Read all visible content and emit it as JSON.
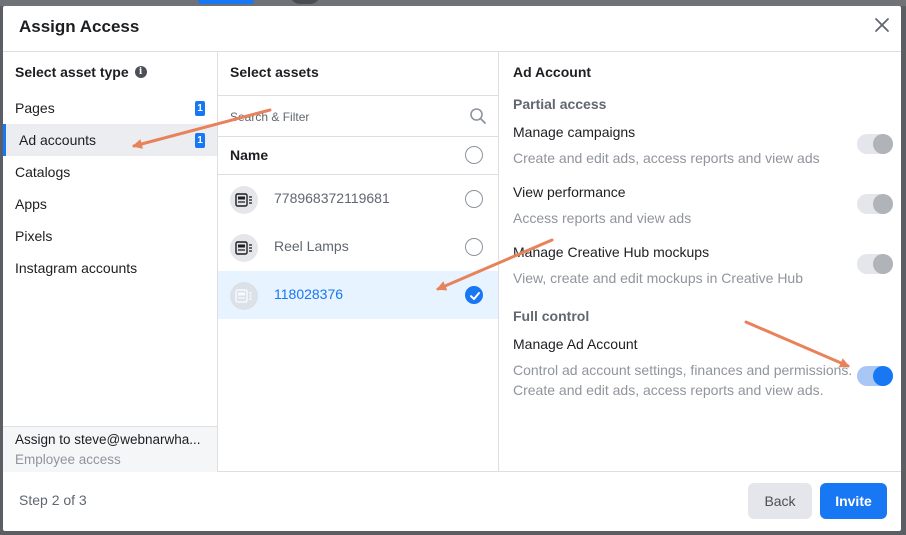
{
  "dialog": {
    "title": "Assign Access",
    "step": "Step 2 of 3",
    "back_label": "Back",
    "invite_label": "Invite"
  },
  "asset_types": {
    "header": "Select asset type",
    "items": [
      {
        "label": "Pages",
        "count": "1"
      },
      {
        "label": "Ad accounts",
        "count": "1",
        "selected": true
      },
      {
        "label": "Catalogs"
      },
      {
        "label": "Apps"
      },
      {
        "label": "Pixels"
      },
      {
        "label": "Instagram accounts"
      }
    ],
    "assign_to": "Assign to steve@webnarwha...",
    "assign_role": "Employee access"
  },
  "assets": {
    "header": "Select assets",
    "search_placeholder": "Search & Filter",
    "name_header": "Name",
    "items": [
      {
        "name": "778968372119681",
        "selected": false
      },
      {
        "name": "Reel Lamps",
        "selected": false
      },
      {
        "name": "118028376",
        "selected": true
      }
    ]
  },
  "permissions": {
    "header": "Ad Account",
    "partial_title": "Partial access",
    "full_title": "Full control",
    "items": [
      {
        "title": "Manage campaigns",
        "desc": "Create and edit ads, access reports and view ads",
        "enabled": false
      },
      {
        "title": "View performance",
        "desc": "Access reports and view ads",
        "enabled": false
      },
      {
        "title": "Manage Creative Hub mockups",
        "desc": "View, create and edit mockups in Creative Hub",
        "enabled": false
      },
      {
        "title": "Manage Ad Account",
        "desc": "Control ad account settings, finances and permissions. Create and edit ads, access reports and view ads.",
        "enabled": true
      }
    ]
  },
  "colors": {
    "accent": "#1877f2",
    "annotation_arrow": "#e8825b"
  }
}
